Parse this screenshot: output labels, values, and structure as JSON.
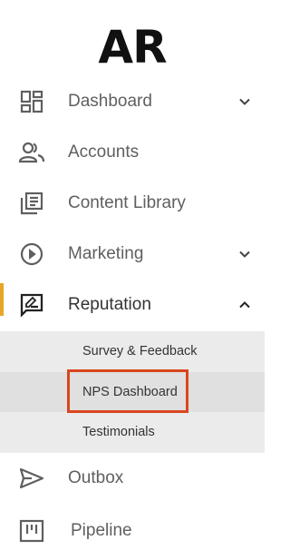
{
  "logo": {
    "text": "AR"
  },
  "nav": {
    "items": [
      {
        "label": "Dashboard",
        "icon": "dashboard-icon",
        "chevron": "chevron-down-icon"
      },
      {
        "label": "Accounts",
        "icon": "users-icon"
      },
      {
        "label": "Content Library",
        "icon": "library-icon"
      },
      {
        "label": "Marketing",
        "icon": "play-circle-icon",
        "chevron": "chevron-down-icon"
      },
      {
        "label": "Reputation",
        "icon": "review-icon",
        "chevron": "chevron-up-icon",
        "active": true
      },
      {
        "label": "Outbox",
        "icon": "send-icon"
      },
      {
        "label": "Pipeline",
        "icon": "pipeline-icon"
      }
    ],
    "reputation_submenu": [
      {
        "label": "Survey & Feedback"
      },
      {
        "label": "NPS Dashboard",
        "highlighted": true
      },
      {
        "label": "Testimonials"
      }
    ]
  },
  "colors": {
    "active_indicator": "#e8a628",
    "highlight_border": "#d9461e",
    "submenu_bg": "#ebebeb",
    "icon": "#5f5f5f"
  }
}
